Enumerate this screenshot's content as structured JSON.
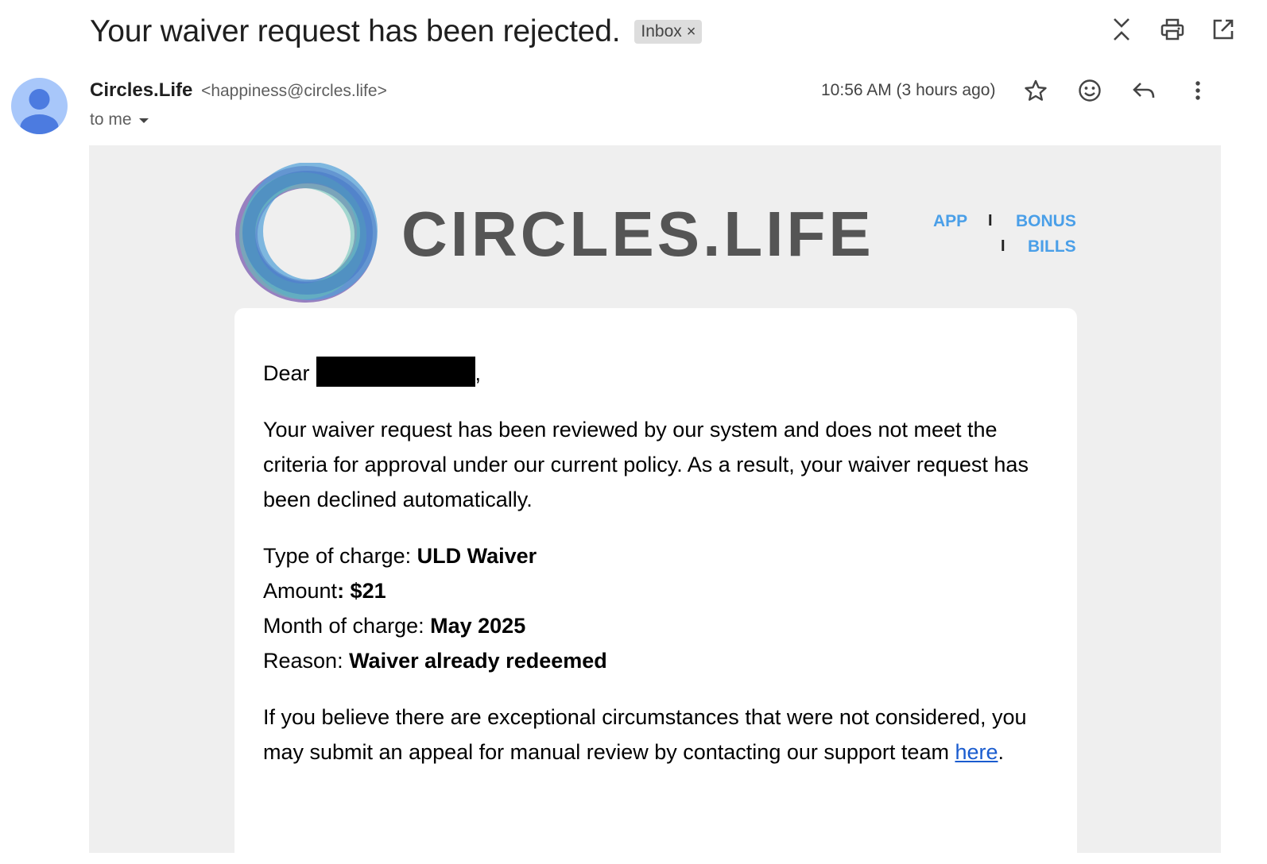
{
  "email": {
    "subject": "Your waiver request has been rejected.",
    "label": "Inbox",
    "label_close": "×",
    "sender_name": "Circles.Life",
    "sender_email": "<happiness@circles.life>",
    "recipient": "to me",
    "timestamp": "10:56 AM (3 hours ago)"
  },
  "icons": {
    "top": [
      "collapse-icon",
      "print-icon",
      "open-in-new-icon"
    ],
    "meta": [
      "star-icon",
      "emoji-icon",
      "reply-icon",
      "more-vert-icon"
    ]
  },
  "brand": {
    "logo_text": "CIRCLES.LIFE",
    "nav": {
      "app": "APP",
      "bonus": "BONUS",
      "bills": "BILLS",
      "separator": "I"
    },
    "link_color": "#4a9fe8"
  },
  "body": {
    "greeting": "Dear",
    "greeting_punct": ",",
    "paragraph1": "Your waiver request has been reviewed by our system and does not meet the criteria for approval under our current policy. As a result, your waiver request has been declined automatically.",
    "details": {
      "type_label": "Type of charge: ",
      "type_value": "ULD Waiver",
      "amount_label": "Amount",
      "amount_value": ": $21",
      "month_label": "Month of charge: ",
      "month_value": "May 2025",
      "reason_label": "Reason: ",
      "reason_value": "Waiver already redeemed"
    },
    "paragraph2": "If you believe there are exceptional circumstances that were not considered, you may submit an appeal for manual review by contacting our support team ",
    "link_text": "here",
    "paragraph2_end": "."
  }
}
